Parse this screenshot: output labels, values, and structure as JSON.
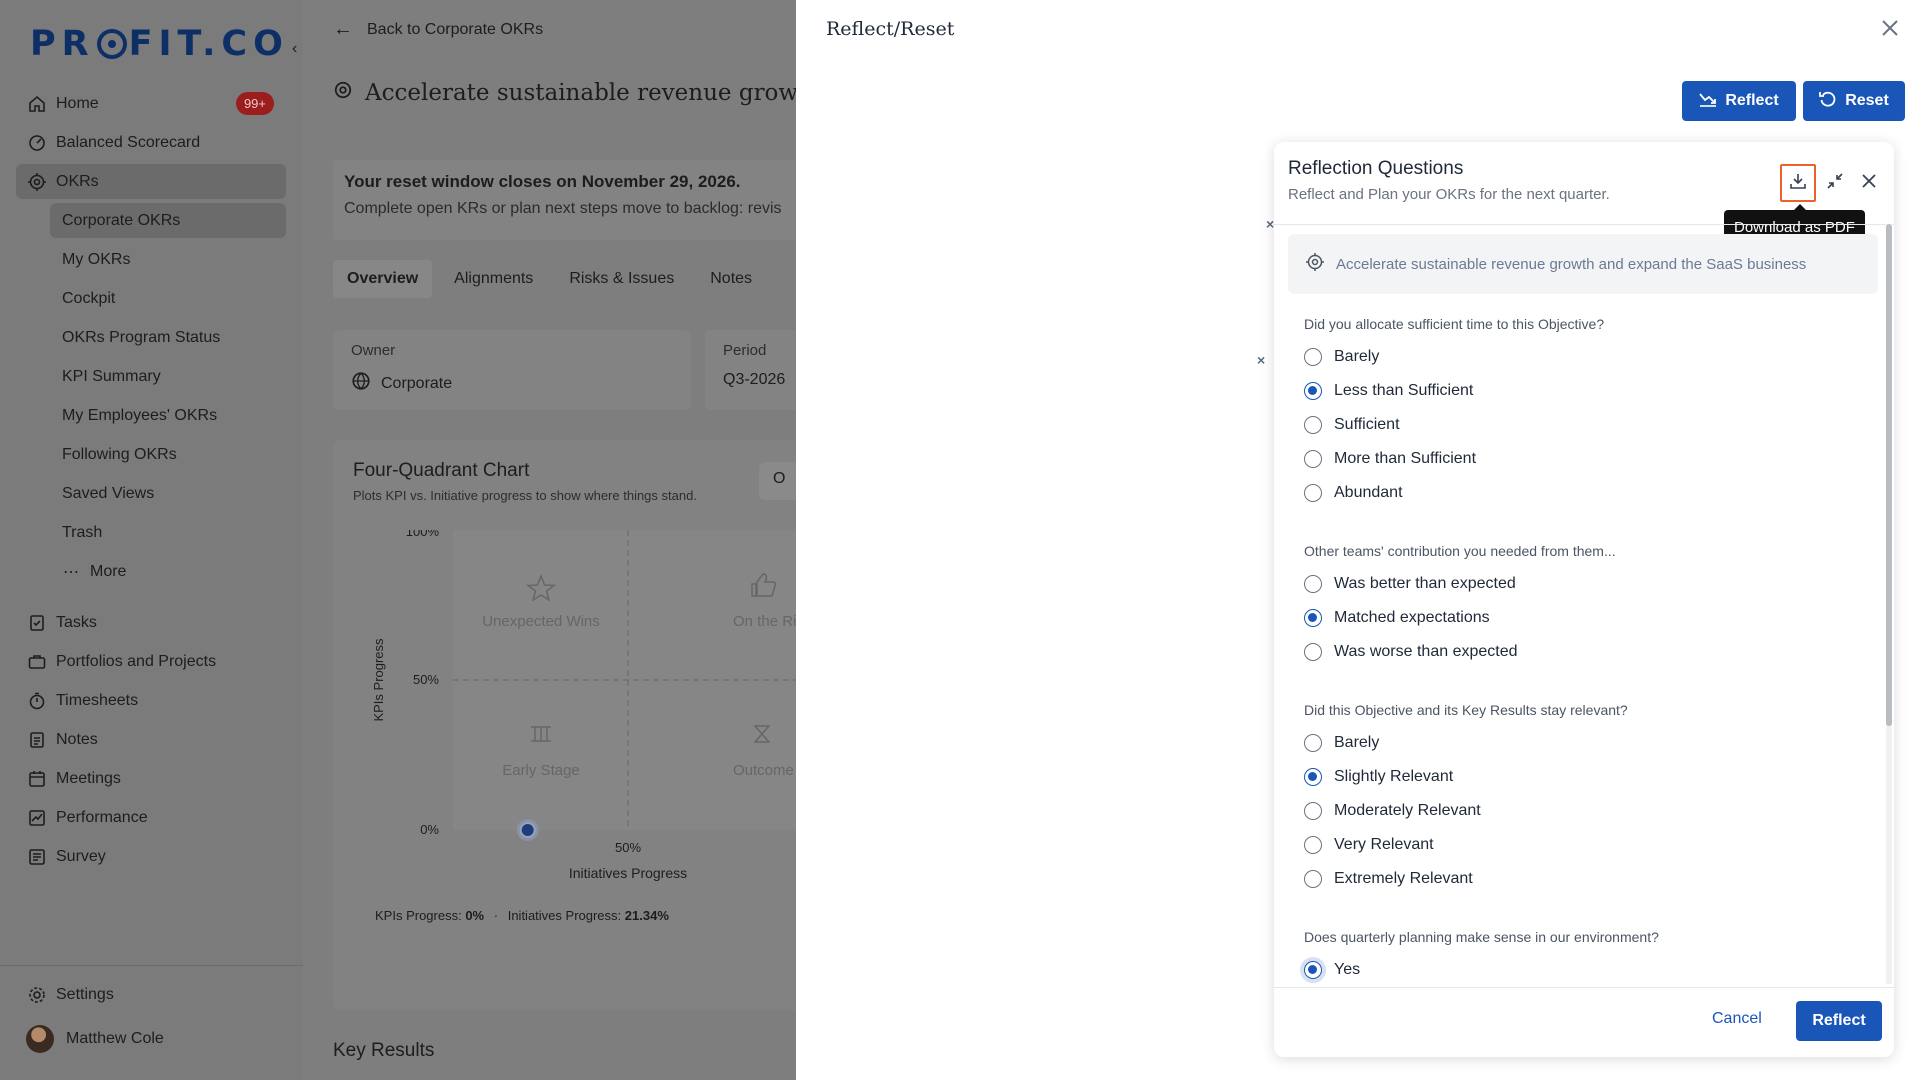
{
  "brand": {
    "logo_text_left": "PR",
    "logo_text_right": "FIT.CO"
  },
  "sidebar": {
    "items": [
      {
        "label": "Home",
        "icon": "home-icon",
        "badge": "99+"
      },
      {
        "label": "Balanced Scorecard",
        "icon": "scorecard-icon"
      },
      {
        "label": "OKRs",
        "icon": "target-icon"
      }
    ],
    "okr_sub": [
      {
        "label": "Corporate OKRs"
      },
      {
        "label": "My OKRs"
      },
      {
        "label": "Cockpit"
      },
      {
        "label": "OKRs Program Status"
      },
      {
        "label": "KPI Summary"
      },
      {
        "label": "My Employees' OKRs"
      },
      {
        "label": "Following OKRs"
      },
      {
        "label": "Saved Views"
      },
      {
        "label": "Trash"
      },
      {
        "label": "More"
      }
    ],
    "bottom_items": [
      {
        "label": "Tasks"
      },
      {
        "label": "Portfolios and Projects"
      },
      {
        "label": "Timesheets"
      },
      {
        "label": "Notes"
      },
      {
        "label": "Meetings"
      },
      {
        "label": "Performance"
      },
      {
        "label": "Survey"
      }
    ],
    "settings": "Settings",
    "user": "Matthew Cole"
  },
  "main": {
    "back": "Back to Corporate OKRs",
    "objective_title": "Accelerate sustainable revenue growth a",
    "banner_title": "Your reset window closes on November 29, 2026.",
    "banner_text": "Complete open KRs or plan next steps move to backlog: revis",
    "tabs": [
      "Overview",
      "Alignments",
      "Risks & Issues",
      "Notes"
    ],
    "owner_label": "Owner",
    "owner_value": "Corporate",
    "period_label": "Period",
    "period_value": "Q3-2026",
    "chart_title": "Four-Quadrant Chart",
    "chart_sub": "Plots KPI vs. Initiative progress to show where things stand.",
    "chart_btn": "O",
    "key_results": "Key Results"
  },
  "chart_data": {
    "type": "scatter",
    "title": "Four-Quadrant Chart",
    "xlabel": "Initiatives Progress",
    "ylabel": "KPIs Progress",
    "y_ticks": [
      "100%",
      "50%",
      "0%"
    ],
    "x_ticks": [
      "50%"
    ],
    "quadrants": [
      "Unexpected Wins",
      "On the Right",
      "Early Stage",
      "Outcome"
    ],
    "points": [
      {
        "x": 21.34,
        "y": 0
      }
    ],
    "footer_kpi_label": "KPIs Progress:",
    "footer_kpi_value": "0%",
    "footer_sep": "·",
    "footer_init_label": "Initiatives Progress:",
    "footer_init_value": "21.34%"
  },
  "drawer": {
    "title": "Reflect/Reset",
    "reflect_btn": "Reflect",
    "reset_btn": "Reset"
  },
  "panel": {
    "title": "Reflection Questions",
    "subtitle": "Reflect and Plan your OKRs for the next quarter.",
    "tooltip": "Download as PDF",
    "objective": "Accelerate sustainable revenue growth and expand the SaaS business",
    "questions": [
      {
        "label": "Did you allocate sufficient time to this Objective?",
        "options": [
          "Barely",
          "Less than Sufficient",
          "Sufficient",
          "More than Sufficient",
          "Abundant"
        ],
        "selected": 1
      },
      {
        "label": "Other teams' contribution you needed from them...",
        "options": [
          "Was better than expected",
          "Matched expectations",
          "Was worse than expected"
        ],
        "selected": 1
      },
      {
        "label": "Did this Objective and its Key Results stay relevant?",
        "options": [
          "Barely",
          "Slightly Relevant",
          "Moderately Relevant",
          "Very Relevant",
          "Extremely Relevant"
        ],
        "selected": 1
      },
      {
        "label": "Does quarterly planning make sense in our environment?",
        "options": [
          "Yes"
        ],
        "selected": 0
      }
    ],
    "cancel": "Cancel",
    "reflect": "Reflect"
  },
  "colors": {
    "primary": "#1a56b8",
    "highlight": "#e8632a",
    "badge": "#9b1d1d"
  }
}
